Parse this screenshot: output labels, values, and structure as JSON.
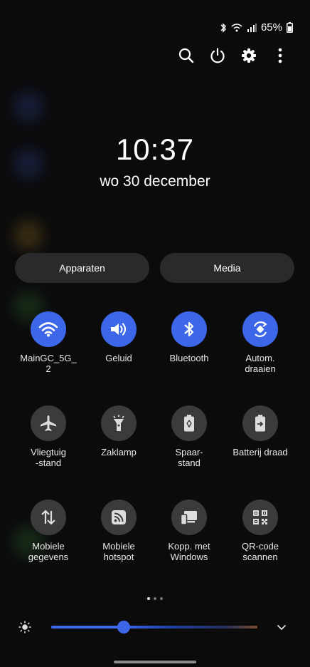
{
  "status_bar": {
    "battery": "65%"
  },
  "header": {
    "time": "10:37",
    "date": "wo 30 december"
  },
  "buttons": {
    "devices": "Apparaten",
    "media": "Media"
  },
  "tiles": [
    {
      "label": "MainGC_5G_\n2",
      "icon": "wifi-icon",
      "state": "on"
    },
    {
      "label": "Geluid",
      "icon": "sound-icon",
      "state": "on"
    },
    {
      "label": "Bluetooth",
      "icon": "bluetooth-icon",
      "state": "on"
    },
    {
      "label": "Autom.\ndraaien",
      "icon": "auto-rotate-icon",
      "state": "on"
    },
    {
      "label": "Vliegtuig\n-stand",
      "icon": "airplane-icon",
      "state": "off"
    },
    {
      "label": "Zaklamp",
      "icon": "flashlight-icon",
      "state": "off"
    },
    {
      "label": "Spaar-\nstand",
      "icon": "power-saving-icon",
      "state": "off"
    },
    {
      "label": "Batterij draad",
      "icon": "battery-share-icon",
      "state": "off"
    },
    {
      "label": "Mobiele\ngegevens",
      "icon": "mobile-data-icon",
      "state": "off"
    },
    {
      "label": "Mobiele\nhotspot",
      "icon": "hotspot-icon",
      "state": "off"
    },
    {
      "label": "Kopp. met\nWindows",
      "icon": "link-windows-icon",
      "state": "off"
    },
    {
      "label": "QR-code\nscannen",
      "icon": "qr-scan-icon",
      "state": "off"
    }
  ],
  "pager": {
    "pages": 3,
    "current": 1
  },
  "brightness": {
    "level": 0.35
  },
  "colors": {
    "accent": "#3c67e8",
    "tile_off": "#3b3b3d",
    "button_bg": "#2a2a2c"
  }
}
